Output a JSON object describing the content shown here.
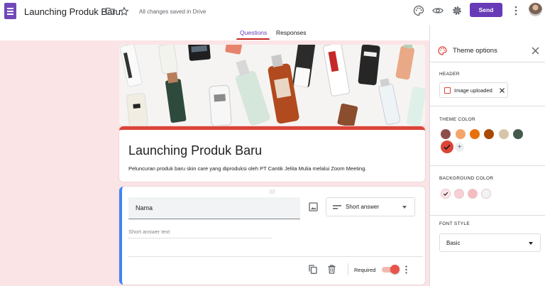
{
  "app": {
    "title": "Launching Produk Baru",
    "save_status": "All changes saved in Drive",
    "send_label": "Send"
  },
  "icons": {
    "logo": "google-forms-icon",
    "folder": "folder-icon",
    "star": "star-icon",
    "palette": "palette-icon",
    "preview": "eye-icon",
    "settings": "gear-icon",
    "more": "more-vert-icon",
    "avatar": "user-avatar"
  },
  "tabs": [
    {
      "label": "Questions",
      "active": true
    },
    {
      "label": "Responses",
      "active": false
    }
  ],
  "form": {
    "title": "Launching Produk Baru",
    "description": "Peluncuran produk baru skin care yang diproduksi oleh PT Cantik Jelita Mulia melalui Zoom Meeting.",
    "question": {
      "text": "Nama",
      "type": "Short answer",
      "answer_hint": "Short answer text",
      "required_label": "Required",
      "required": true
    }
  },
  "theme": {
    "title": "Theme options",
    "header": {
      "label": "HEADER",
      "chip": "Image uploaded"
    },
    "theme_color": {
      "label": "THEME COLOR",
      "colors": [
        "#8d4e4b",
        "#f4a56a",
        "#e8710a",
        "#a84a00",
        "#d6c6a8",
        "#455a4d",
        "#db4437"
      ],
      "selected": "#db4437"
    },
    "background_color": {
      "label": "BACKGROUND COLOR",
      "colors": [
        "#fbe4e6",
        "#f8d0d3",
        "#f4bcc0",
        "#f1f3f4"
      ],
      "selected": "#fbe4e6"
    },
    "font_style": {
      "label": "FONT STYLE",
      "value": "Basic"
    }
  },
  "colors": {
    "accent": "#673ab7",
    "theme": "#db4437",
    "background": "#fbe4e6",
    "question_indicator": "#4285f4"
  }
}
